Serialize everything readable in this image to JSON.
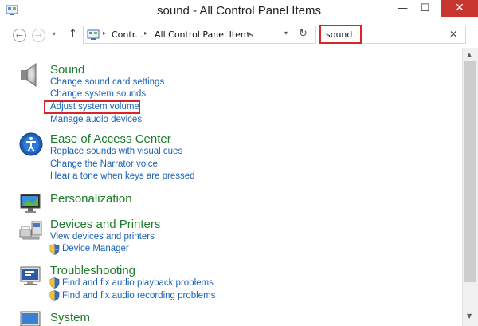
{
  "window": {
    "title": "sound - All Control Panel Items",
    "minimize": "—",
    "maximize": "☐",
    "close": "✕"
  },
  "nav": {
    "back": "←",
    "forward": "→",
    "recent": "▾",
    "up": "↑"
  },
  "address": {
    "separator": "▸",
    "crumbs": [
      "Contr...",
      "All Control Panel Items"
    ],
    "dropdown": "▾",
    "refresh": "↻"
  },
  "search": {
    "value": "sound",
    "clear": "✕"
  },
  "scroll": {
    "up": "▲",
    "down": "▼"
  },
  "results": [
    {
      "title": "Sound",
      "icon": "speaker-icon",
      "links": [
        "Change sound card settings",
        "Change system sounds",
        "Adjust system volume",
        "Manage audio devices"
      ]
    },
    {
      "title": "Ease of Access Center",
      "icon": "ease-of-access-icon",
      "links": [
        "Replace sounds with visual cues",
        "Change the Narrator voice",
        "Hear a tone when keys are pressed"
      ]
    },
    {
      "title": "Personalization",
      "icon": "personalization-icon",
      "links": []
    },
    {
      "title": "Devices and Printers",
      "icon": "devices-printers-icon",
      "links": [
        "View devices and printers",
        "Device Manager"
      ]
    },
    {
      "title": "Troubleshooting",
      "icon": "troubleshooting-icon",
      "links": [
        "Find and fix audio playback problems",
        "Find and fix audio recording problems"
      ]
    },
    {
      "title": "System",
      "icon": "system-icon",
      "links": []
    }
  ],
  "colors": {
    "title_green": "#1e7b2a",
    "link_blue": "#1a62b8",
    "highlight_red": "#d6262b"
  }
}
